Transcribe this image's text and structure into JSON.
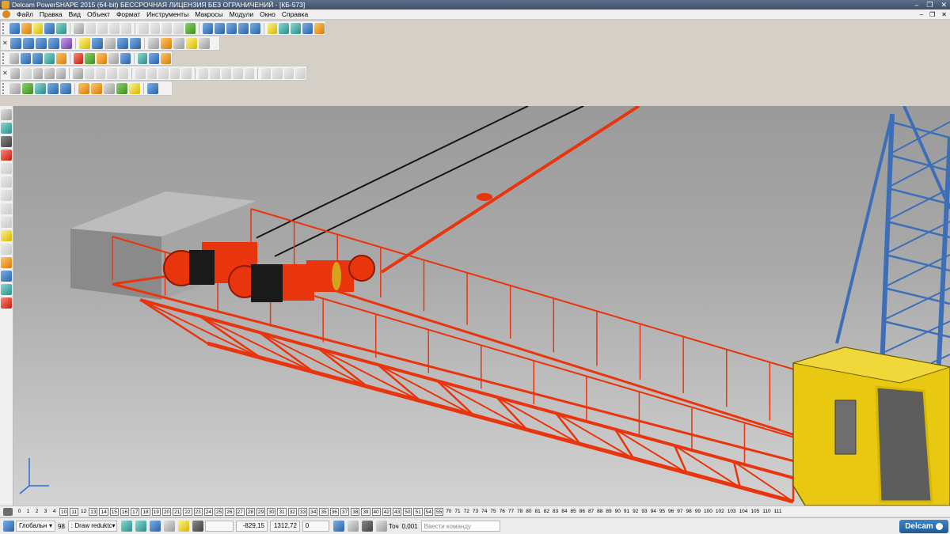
{
  "window": {
    "title": "Delcam PowerSHAPE 2015 (64-bit) БЕССРОЧНАЯ ЛИЦЕНЗИЯ БЕЗ ОГРАНИЧЕНИЙ - [КБ-573]",
    "controls": [
      "–",
      "❐",
      "✕"
    ],
    "mdi_controls": [
      "–",
      "❐",
      "✕"
    ]
  },
  "menu": [
    "Файл",
    "Правка",
    "Вид",
    "Объект",
    "Формат",
    "Инструменты",
    "Макросы",
    "Модули",
    "Окно",
    "Справка"
  ],
  "toolbars": {
    "row1": [
      {
        "icon": "new-model-icon",
        "color": "blue"
      },
      {
        "icon": "open-model-icon",
        "color": "orange"
      },
      {
        "icon": "open-recent-icon",
        "color": "yellow"
      },
      {
        "icon": "save-icon",
        "color": "blue"
      },
      {
        "icon": "save-as-icon",
        "color": "teal"
      },
      {
        "icon": "print-icon",
        "color": "gray"
      },
      {
        "icon": "cut-icon",
        "color": "gray",
        "disabled": true
      },
      {
        "icon": "copy-icon",
        "color": "gray",
        "disabled": true
      },
      {
        "icon": "paste-icon",
        "color": "gray",
        "disabled": true
      },
      {
        "icon": "eraser-icon",
        "color": "gray",
        "disabled": true
      },
      {
        "icon": "delete-icon",
        "color": "gray",
        "disabled": true
      },
      {
        "icon": "undo-icon",
        "color": "gray",
        "disabled": true
      },
      {
        "icon": "redo-icon",
        "color": "gray",
        "disabled": true
      },
      {
        "icon": "repeat-icon",
        "color": "gray",
        "disabled": true
      },
      {
        "icon": "select-icon",
        "color": "green"
      },
      {
        "icon": "line-icon",
        "color": "blue"
      },
      {
        "icon": "arc-icon",
        "color": "blue"
      },
      {
        "icon": "circle-icon",
        "color": "blue"
      },
      {
        "icon": "curve-icon",
        "color": "blue"
      },
      {
        "icon": "text-icon",
        "color": "blue"
      },
      {
        "icon": "dimension-icon",
        "color": "yellow"
      },
      {
        "icon": "surface-icon",
        "color": "teal"
      },
      {
        "icon": "solid-icon",
        "color": "teal"
      },
      {
        "icon": "layers-icon",
        "color": "blue"
      },
      {
        "icon": "wizard-icon",
        "color": "orange"
      }
    ],
    "row2": [
      {
        "icon": "view-top-icon",
        "color": "blue"
      },
      {
        "icon": "view-front-icon",
        "color": "blue"
      },
      {
        "icon": "view-side-icon",
        "color": "blue"
      },
      {
        "icon": "view-iso-icon",
        "color": "blue"
      },
      {
        "icon": "view-iso2-icon",
        "color": "purple"
      },
      {
        "icon": "zoom-in-icon",
        "color": "yellow"
      },
      {
        "icon": "zoom-out-icon",
        "color": "blue"
      },
      {
        "icon": "zoom-fit-icon",
        "color": "gray"
      },
      {
        "icon": "zoom-window-icon",
        "color": "blue"
      },
      {
        "icon": "zoom-select-icon",
        "color": "blue"
      },
      {
        "icon": "globe-icon",
        "color": "gray"
      },
      {
        "icon": "shading-icon",
        "color": "orange"
      },
      {
        "icon": "wireframe-icon",
        "color": "gray"
      },
      {
        "icon": "light-icon",
        "color": "yellow"
      },
      {
        "icon": "hand-icon",
        "color": "gray"
      }
    ],
    "row3": [
      {
        "icon": "calculator-icon",
        "color": "gray"
      },
      {
        "icon": "document-icon",
        "color": "blue"
      },
      {
        "icon": "render-icon",
        "color": "blue"
      },
      {
        "icon": "material-icon",
        "color": "teal"
      },
      {
        "icon": "color-sphere-icon",
        "color": "orange"
      },
      {
        "icon": "red-sphere-icon",
        "color": "red"
      },
      {
        "icon": "play-icon",
        "color": "green"
      },
      {
        "icon": "cube-icon",
        "color": "orange"
      },
      {
        "icon": "cubes-icon",
        "color": "gray"
      },
      {
        "icon": "info-icon",
        "color": "blue"
      },
      {
        "icon": "frame-icon",
        "color": "teal"
      },
      {
        "icon": "palette-icon",
        "color": "blue"
      },
      {
        "icon": "arrows-icon",
        "color": "orange"
      }
    ],
    "row4": [
      {
        "icon": "surface-tool-icon",
        "color": "gray"
      },
      {
        "icon": "surface-edit-icon",
        "color": "gray",
        "disabled": true
      },
      {
        "icon": "patch-icon",
        "color": "gray"
      },
      {
        "icon": "solid-box-icon",
        "color": "gray"
      },
      {
        "icon": "solid-box-sel-icon",
        "color": "gray"
      },
      {
        "icon": "solid-edit-icon",
        "color": "gray"
      },
      {
        "icon": "solid-cut-icon",
        "color": "gray",
        "disabled": true
      },
      {
        "icon": "solid-copy-icon",
        "color": "gray",
        "disabled": true
      },
      {
        "icon": "solid-move-icon",
        "color": "gray",
        "disabled": true
      },
      {
        "icon": "feature-1-icon",
        "color": "gray",
        "disabled": true
      },
      {
        "icon": "feature-2-icon",
        "color": "gray",
        "disabled": true
      },
      {
        "icon": "feature-3-icon",
        "color": "gray",
        "disabled": true
      },
      {
        "icon": "feature-4-icon",
        "color": "gray",
        "disabled": true
      },
      {
        "icon": "feature-5-icon",
        "color": "gray",
        "disabled": true
      },
      {
        "icon": "feature-6-icon",
        "color": "gray",
        "disabled": true
      },
      {
        "icon": "feature-7-icon",
        "color": "gray",
        "disabled": true
      },
      {
        "icon": "feature-8-icon",
        "color": "gray",
        "disabled": true
      },
      {
        "icon": "feature-9-icon",
        "color": "gray",
        "disabled": true
      },
      {
        "icon": "feature-10-icon",
        "color": "gray",
        "disabled": true
      },
      {
        "icon": "feature-11-icon",
        "color": "gray",
        "disabled": true
      },
      {
        "icon": "feature-12-icon",
        "color": "gray",
        "disabled": true
      },
      {
        "icon": "feature-13-icon",
        "color": "gray",
        "disabled": true
      },
      {
        "icon": "feature-14-icon",
        "color": "gray",
        "disabled": true
      },
      {
        "icon": "feature-15-icon",
        "color": "gray",
        "disabled": true
      }
    ],
    "row5": [
      {
        "icon": "model-tool-icon",
        "color": "gray"
      },
      {
        "icon": "axes-icon",
        "color": "green"
      },
      {
        "icon": "workplane-icon",
        "color": "teal"
      },
      {
        "icon": "block-icon",
        "color": "blue"
      },
      {
        "icon": "block-group-icon",
        "color": "blue"
      },
      {
        "icon": "block-cut-icon",
        "color": "orange"
      },
      {
        "icon": "block-orange-icon",
        "color": "orange"
      },
      {
        "icon": "block-list-icon",
        "color": "gray"
      },
      {
        "icon": "assembly-icon",
        "color": "green"
      },
      {
        "icon": "drawing-icon",
        "color": "yellow"
      },
      {
        "icon": "paint-icon",
        "color": "blue"
      }
    ],
    "left": [
      {
        "icon": "pointer-icon",
        "color": "gray"
      },
      {
        "icon": "layers-panel-icon",
        "color": "teal"
      },
      {
        "icon": "line-tool-icon",
        "color": "dark"
      },
      {
        "icon": "warning-icon",
        "color": "red"
      },
      {
        "icon": "arc-tool-icon",
        "color": "gray",
        "disabled": true
      },
      {
        "icon": "ruler-icon",
        "color": "gray",
        "disabled": true
      },
      {
        "icon": "grid-icon",
        "color": "gray",
        "disabled": true
      },
      {
        "icon": "disabled-1-icon",
        "color": "gray",
        "disabled": true
      },
      {
        "icon": "disabled-2-icon",
        "color": "gray",
        "disabled": true
      },
      {
        "icon": "surface-panel-icon",
        "color": "yellow"
      },
      {
        "icon": "disabled-3-icon",
        "color": "gray",
        "disabled": true
      },
      {
        "icon": "color-panel-icon",
        "color": "orange"
      },
      {
        "icon": "color-panel-2-icon",
        "color": "blue"
      },
      {
        "icon": "solid-panel-icon",
        "color": "teal"
      },
      {
        "icon": "render-panel-icon",
        "color": "red"
      }
    ]
  },
  "levels": [
    "0",
    "1",
    "2",
    "3",
    "4",
    "10",
    "11",
    "12",
    "13",
    "14",
    "15",
    "16",
    "17",
    "18",
    "19",
    "20",
    "21",
    "22",
    "23",
    "24",
    "25",
    "26",
    "27",
    "28",
    "29",
    "30",
    "31",
    "32",
    "33",
    "34",
    "35",
    "36",
    "37",
    "38",
    "39",
    "40",
    "42",
    "43",
    "50",
    "51",
    "54",
    "55",
    "70",
    "71",
    "72",
    "73",
    "74",
    "75",
    "76",
    "77",
    "78",
    "80",
    "81",
    "82",
    "83",
    "84",
    "85",
    "86",
    "87",
    "88",
    "89",
    "90",
    "91",
    "92",
    "93",
    "94",
    "95",
    "96",
    "97",
    "98",
    "99",
    "100",
    "102",
    "103",
    "104",
    "105",
    "110",
    "111"
  ],
  "levels_boxed": [
    "10",
    "11",
    "13",
    "14",
    "15",
    "16",
    "17",
    "18",
    "19",
    "20",
    "21",
    "22",
    "23",
    "24",
    "25",
    "26",
    "27",
    "28",
    "29",
    "30",
    "31",
    "32",
    "33",
    "34",
    "35",
    "36",
    "37",
    "38",
    "39",
    "40",
    "42",
    "43",
    "50",
    "51",
    "54",
    "55"
  ],
  "status": {
    "workplane": "Глобальн",
    "level_number": "98",
    "level_name": ": Draw reduktc",
    "coord_x": "-829,15",
    "coord_y": "1312,72",
    "coord_z": "0",
    "tolerance_label": "Точ",
    "tolerance_value": "0,001",
    "command_placeholder": "Ввести команду",
    "logo": "Delcam"
  },
  "colors": {
    "boom": "#e8350e",
    "tower": "#3d6fb8",
    "cabin": "#e8c810",
    "counterweight": "#9c9c9c",
    "cable": "#151515"
  }
}
